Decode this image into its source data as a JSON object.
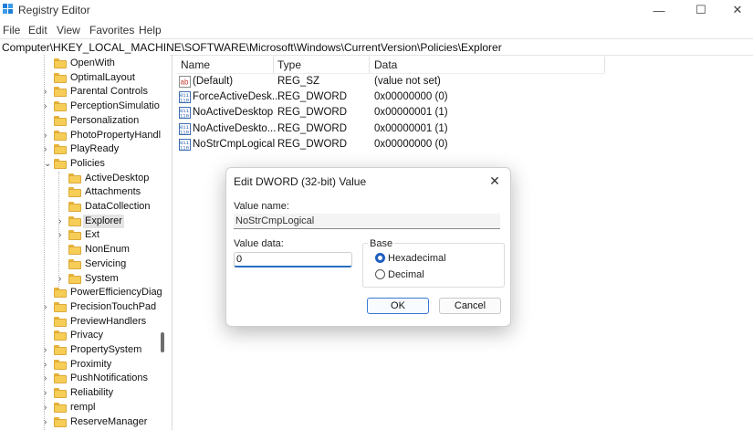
{
  "window": {
    "title": "Registry Editor",
    "minimize_glyph": "—",
    "maximize_glyph": "☐",
    "close_glyph": "✕"
  },
  "menu": {
    "items": [
      "File",
      "Edit",
      "View",
      "Favorites",
      "Help"
    ]
  },
  "address": {
    "path": "Computer\\HKEY_LOCAL_MACHINE\\SOFTWARE\\Microsoft\\Windows\\CurrentVersion\\Policies\\Explorer"
  },
  "tree": {
    "items": [
      {
        "label": "OpenWith",
        "expand": ""
      },
      {
        "label": "OptimalLayout",
        "expand": ""
      },
      {
        "label": "Parental Controls",
        "expand": ">"
      },
      {
        "label": "PerceptionSimulatio",
        "expand": ">"
      },
      {
        "label": "Personalization",
        "expand": ""
      },
      {
        "label": "PhotoPropertyHandl",
        "expand": ">"
      },
      {
        "label": "PlayReady",
        "expand": ">"
      },
      {
        "label": "Policies",
        "expand": "v"
      },
      {
        "label": "ActiveDesktop",
        "expand": ""
      },
      {
        "label": "Attachments",
        "expand": ""
      },
      {
        "label": "DataCollection",
        "expand": ""
      },
      {
        "label": "Explorer",
        "expand": ">"
      },
      {
        "label": "Ext",
        "expand": ">"
      },
      {
        "label": "NonEnum",
        "expand": ""
      },
      {
        "label": "Servicing",
        "expand": ""
      },
      {
        "label": "System",
        "expand": ">"
      },
      {
        "label": "PowerEfficiencyDiag",
        "expand": ""
      },
      {
        "label": "PrecisionTouchPad",
        "expand": ">"
      },
      {
        "label": "PreviewHandlers",
        "expand": ""
      },
      {
        "label": "Privacy",
        "expand": ""
      },
      {
        "label": "PropertySystem",
        "expand": ">"
      },
      {
        "label": "Proximity",
        "expand": ">"
      },
      {
        "label": "PushNotifications",
        "expand": ">"
      },
      {
        "label": "Reliability",
        "expand": ">"
      },
      {
        "label": "rempl",
        "expand": ">"
      },
      {
        "label": "ReserveManager",
        "expand": ">"
      }
    ]
  },
  "list": {
    "headers": {
      "name": "Name",
      "type": "Type",
      "data": "Data"
    },
    "rows": [
      {
        "name": "(Default)",
        "type": "REG_SZ",
        "data": "(value not set)",
        "icon": "string-value-icon"
      },
      {
        "name": "ForceActiveDesk...",
        "type": "REG_DWORD",
        "data": "0x00000000 (0)",
        "icon": "binary-value-icon"
      },
      {
        "name": "NoActiveDesktop",
        "type": "REG_DWORD",
        "data": "0x00000001 (1)",
        "icon": "binary-value-icon"
      },
      {
        "name": "NoActiveDeskto...",
        "type": "REG_DWORD",
        "data": "0x00000001 (1)",
        "icon": "binary-value-icon"
      },
      {
        "name": "NoStrCmpLogical",
        "type": "REG_DWORD",
        "data": "0x00000000 (0)",
        "icon": "binary-value-icon"
      }
    ]
  },
  "dialog": {
    "title": "Edit DWORD (32-bit) Value",
    "close_glyph": "✕",
    "value_name_label": "Value name:",
    "value_name": "NoStrCmpLogical",
    "value_data_label": "Value data:",
    "value_data": "0",
    "base_label": "Base",
    "radio_hex": "Hexadecimal",
    "radio_dec": "Decimal",
    "selected_base": "Hexadecimal",
    "ok": "OK",
    "cancel": "Cancel"
  },
  "colors": {
    "accent": "#1f5fbf",
    "folder": "#f6cd57",
    "selection": "#e4e4e4"
  }
}
